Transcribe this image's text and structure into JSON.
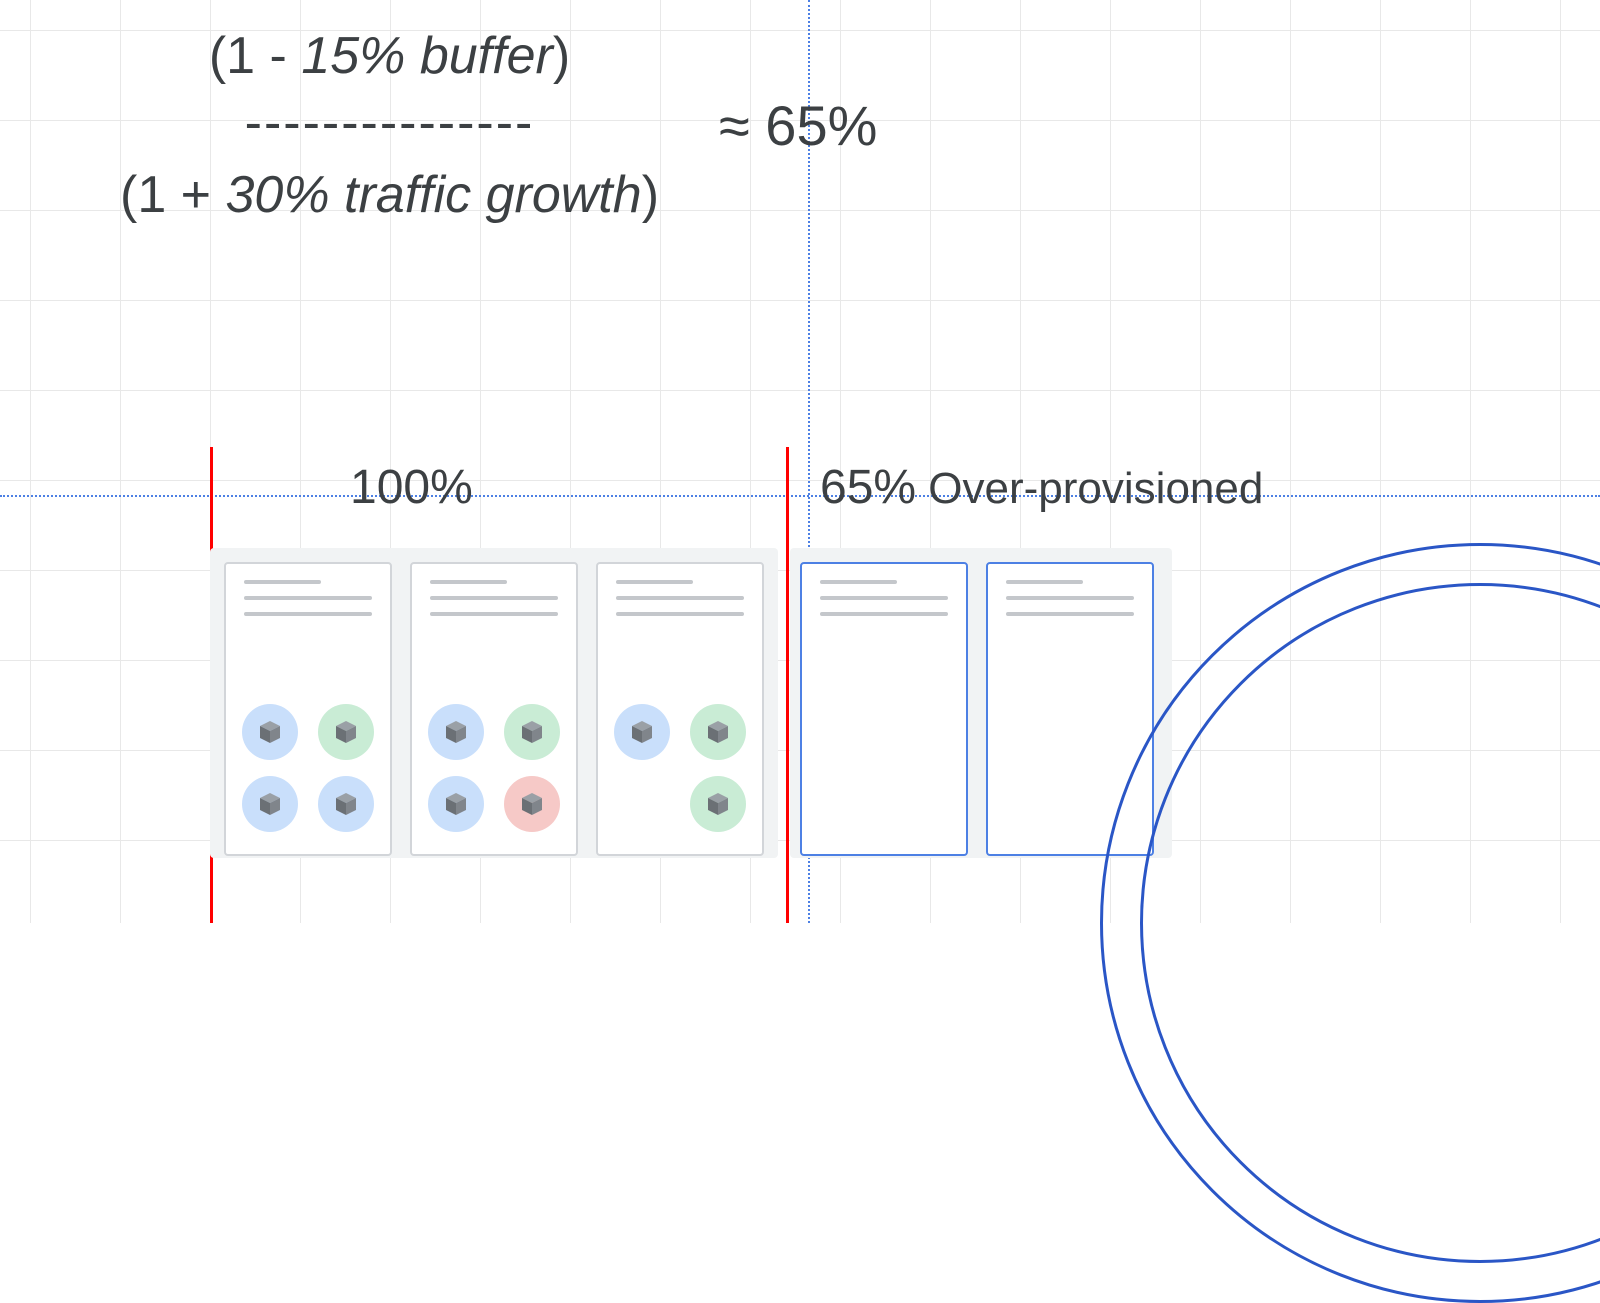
{
  "formula": {
    "numerator_prefix": "(1 - ",
    "numerator_ital": "15% buffer",
    "numerator_suffix": ")",
    "divider": "---------------",
    "denominator_prefix": "(1 + ",
    "denominator_ital": "30% traffic growth",
    "denominator_suffix": ")",
    "approx": "≈  65%"
  },
  "labels": {
    "full": "100%",
    "extra_pct": "65%",
    "extra_txt": " Over-provisioned"
  },
  "servers": {
    "active": [
      {
        "pods": [
          "blue",
          "green",
          "blue",
          "blue"
        ]
      },
      {
        "pods": [
          "blue",
          "green",
          "blue",
          "red"
        ]
      },
      {
        "pods": [
          "blue",
          "green",
          "empty",
          "green"
        ]
      }
    ],
    "spare_count": 2
  }
}
